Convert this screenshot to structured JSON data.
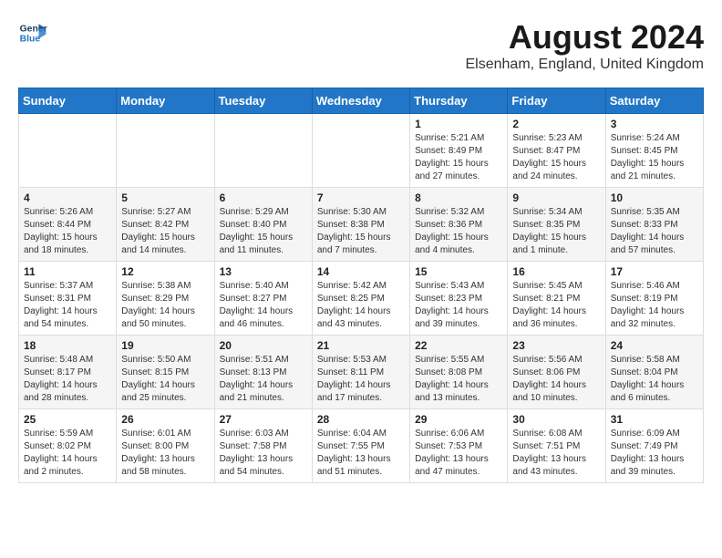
{
  "logo": {
    "line1": "General",
    "line2": "Blue"
  },
  "title": "August 2024",
  "subtitle": "Elsenham, England, United Kingdom",
  "days_header": [
    "Sunday",
    "Monday",
    "Tuesday",
    "Wednesday",
    "Thursday",
    "Friday",
    "Saturday"
  ],
  "weeks": [
    [
      {
        "day": "",
        "text": ""
      },
      {
        "day": "",
        "text": ""
      },
      {
        "day": "",
        "text": ""
      },
      {
        "day": "",
        "text": ""
      },
      {
        "day": "1",
        "text": "Sunrise: 5:21 AM\nSunset: 8:49 PM\nDaylight: 15 hours\nand 27 minutes."
      },
      {
        "day": "2",
        "text": "Sunrise: 5:23 AM\nSunset: 8:47 PM\nDaylight: 15 hours\nand 24 minutes."
      },
      {
        "day": "3",
        "text": "Sunrise: 5:24 AM\nSunset: 8:45 PM\nDaylight: 15 hours\nand 21 minutes."
      }
    ],
    [
      {
        "day": "4",
        "text": "Sunrise: 5:26 AM\nSunset: 8:44 PM\nDaylight: 15 hours\nand 18 minutes."
      },
      {
        "day": "5",
        "text": "Sunrise: 5:27 AM\nSunset: 8:42 PM\nDaylight: 15 hours\nand 14 minutes."
      },
      {
        "day": "6",
        "text": "Sunrise: 5:29 AM\nSunset: 8:40 PM\nDaylight: 15 hours\nand 11 minutes."
      },
      {
        "day": "7",
        "text": "Sunrise: 5:30 AM\nSunset: 8:38 PM\nDaylight: 15 hours\nand 7 minutes."
      },
      {
        "day": "8",
        "text": "Sunrise: 5:32 AM\nSunset: 8:36 PM\nDaylight: 15 hours\nand 4 minutes."
      },
      {
        "day": "9",
        "text": "Sunrise: 5:34 AM\nSunset: 8:35 PM\nDaylight: 15 hours\nand 1 minute."
      },
      {
        "day": "10",
        "text": "Sunrise: 5:35 AM\nSunset: 8:33 PM\nDaylight: 14 hours\nand 57 minutes."
      }
    ],
    [
      {
        "day": "11",
        "text": "Sunrise: 5:37 AM\nSunset: 8:31 PM\nDaylight: 14 hours\nand 54 minutes."
      },
      {
        "day": "12",
        "text": "Sunrise: 5:38 AM\nSunset: 8:29 PM\nDaylight: 14 hours\nand 50 minutes."
      },
      {
        "day": "13",
        "text": "Sunrise: 5:40 AM\nSunset: 8:27 PM\nDaylight: 14 hours\nand 46 minutes."
      },
      {
        "day": "14",
        "text": "Sunrise: 5:42 AM\nSunset: 8:25 PM\nDaylight: 14 hours\nand 43 minutes."
      },
      {
        "day": "15",
        "text": "Sunrise: 5:43 AM\nSunset: 8:23 PM\nDaylight: 14 hours\nand 39 minutes."
      },
      {
        "day": "16",
        "text": "Sunrise: 5:45 AM\nSunset: 8:21 PM\nDaylight: 14 hours\nand 36 minutes."
      },
      {
        "day": "17",
        "text": "Sunrise: 5:46 AM\nSunset: 8:19 PM\nDaylight: 14 hours\nand 32 minutes."
      }
    ],
    [
      {
        "day": "18",
        "text": "Sunrise: 5:48 AM\nSunset: 8:17 PM\nDaylight: 14 hours\nand 28 minutes."
      },
      {
        "day": "19",
        "text": "Sunrise: 5:50 AM\nSunset: 8:15 PM\nDaylight: 14 hours\nand 25 minutes."
      },
      {
        "day": "20",
        "text": "Sunrise: 5:51 AM\nSunset: 8:13 PM\nDaylight: 14 hours\nand 21 minutes."
      },
      {
        "day": "21",
        "text": "Sunrise: 5:53 AM\nSunset: 8:11 PM\nDaylight: 14 hours\nand 17 minutes."
      },
      {
        "day": "22",
        "text": "Sunrise: 5:55 AM\nSunset: 8:08 PM\nDaylight: 14 hours\nand 13 minutes."
      },
      {
        "day": "23",
        "text": "Sunrise: 5:56 AM\nSunset: 8:06 PM\nDaylight: 14 hours\nand 10 minutes."
      },
      {
        "day": "24",
        "text": "Sunrise: 5:58 AM\nSunset: 8:04 PM\nDaylight: 14 hours\nand 6 minutes."
      }
    ],
    [
      {
        "day": "25",
        "text": "Sunrise: 5:59 AM\nSunset: 8:02 PM\nDaylight: 14 hours\nand 2 minutes."
      },
      {
        "day": "26",
        "text": "Sunrise: 6:01 AM\nSunset: 8:00 PM\nDaylight: 13 hours\nand 58 minutes."
      },
      {
        "day": "27",
        "text": "Sunrise: 6:03 AM\nSunset: 7:58 PM\nDaylight: 13 hours\nand 54 minutes."
      },
      {
        "day": "28",
        "text": "Sunrise: 6:04 AM\nSunset: 7:55 PM\nDaylight: 13 hours\nand 51 minutes."
      },
      {
        "day": "29",
        "text": "Sunrise: 6:06 AM\nSunset: 7:53 PM\nDaylight: 13 hours\nand 47 minutes."
      },
      {
        "day": "30",
        "text": "Sunrise: 6:08 AM\nSunset: 7:51 PM\nDaylight: 13 hours\nand 43 minutes."
      },
      {
        "day": "31",
        "text": "Sunrise: 6:09 AM\nSunset: 7:49 PM\nDaylight: 13 hours\nand 39 minutes."
      }
    ]
  ]
}
